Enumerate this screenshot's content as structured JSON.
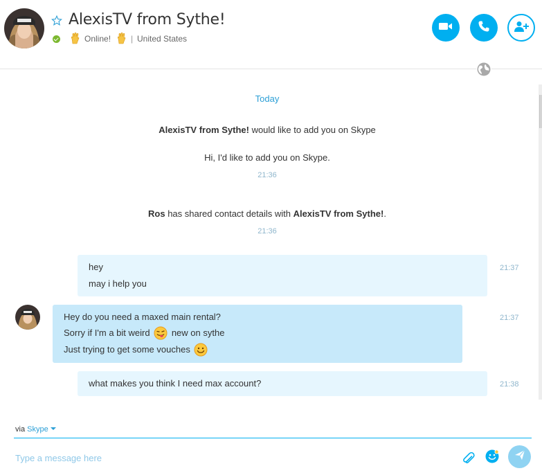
{
  "header": {
    "contact_name": "AlexisTV from Sythe!",
    "status_text": "Online!",
    "location": "United States",
    "separator": "|"
  },
  "colors": {
    "accent": "#00aff0",
    "online": "#7cb82f",
    "incoming_bubble": "#c7e9fa",
    "outgoing_bubble": "#e6f6fe"
  },
  "icons": {
    "favorite": "star-icon",
    "video": "video-call-icon",
    "call": "phone-icon",
    "add": "add-contact-icon",
    "globe": "globe-icon",
    "attach": "paperclip-icon",
    "emoticon": "emoticon-icon",
    "send": "send-icon"
  },
  "conversation": {
    "date_divider": "Today",
    "events": [
      {
        "bold": "AlexisTV from Sythe!",
        "text": " would like to add you on Skype",
        "message": "Hi, I'd like to add you on Skype.",
        "time": "21:36"
      },
      {
        "bold1": "Ros",
        "text1": " has shared contact details with ",
        "bold2": "AlexisTV from Sythe!",
        "text2": ".",
        "time": "21:36"
      }
    ],
    "messages": [
      {
        "direction": "out",
        "lines": [
          "hey",
          "may i help you"
        ],
        "time": "21:37"
      },
      {
        "direction": "in",
        "lines": [
          "Hey do you need a maxed main rental?",
          "Sorry if I'm a bit weird",
          "new on sythe",
          "Just trying to get some vouches"
        ],
        "emoticons": [
          "tongue-out-emoticon",
          "smile-emoticon"
        ],
        "time": "21:37"
      },
      {
        "direction": "out",
        "lines": [
          "what makes you think I need max account?"
        ],
        "time": "21:38"
      }
    ]
  },
  "composer": {
    "via_label": "via",
    "via_service": "Skype",
    "placeholder": "Type a message here"
  }
}
